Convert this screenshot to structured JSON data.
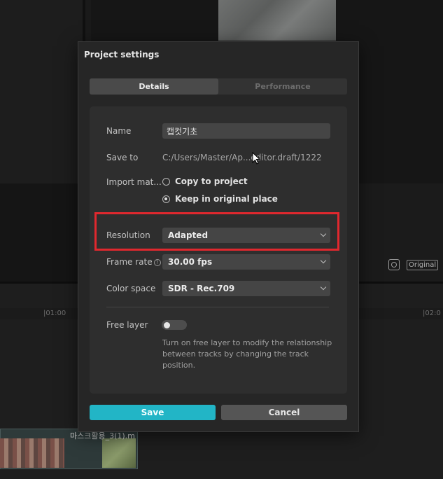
{
  "background": {
    "original_badge": "Original",
    "timeline_ticks": [
      "|01:00",
      "|02:0"
    ],
    "clip_label": "마스크활용_3(1).m"
  },
  "dialog": {
    "title": "Project settings",
    "tabs": [
      {
        "label": "Details",
        "active": true
      },
      {
        "label": "Performance",
        "active": false
      }
    ],
    "fields": {
      "name_label": "Name",
      "name_value": "캡컷기초",
      "save_to_label": "Save to",
      "save_to_value": "C:/Users/Master/Ap...editor.draft/1222",
      "import_label": "Import mat...",
      "import_options": [
        {
          "label": "Copy to project",
          "selected": false
        },
        {
          "label": "Keep in original place",
          "selected": true
        }
      ],
      "resolution_label": "Resolution",
      "resolution_value": "Adapted",
      "frame_rate_label": "Frame rate",
      "frame_rate_value": "30.00 fps",
      "color_space_label": "Color space",
      "color_space_value": "SDR - Rec.709",
      "free_layer_label": "Free layer",
      "free_layer_on": false,
      "free_layer_desc": "Turn on free layer to modify the relationship between tracks by changing the track position."
    },
    "buttons": {
      "save": "Save",
      "cancel": "Cancel"
    }
  },
  "colors": {
    "accent": "#22b5c6",
    "highlight": "#e0282e"
  }
}
